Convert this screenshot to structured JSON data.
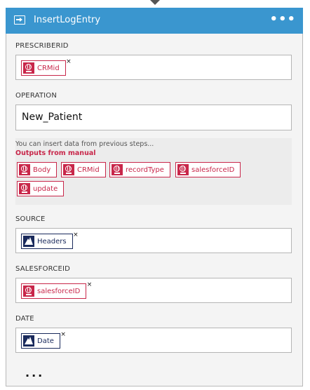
{
  "header": {
    "title": "InsertLogEntry",
    "more_label": "•••",
    "icon": "action-icon",
    "color": "#3a96cf"
  },
  "fields": {
    "prescriberid": {
      "label": "PRESCRIBERID",
      "tokens": [
        {
          "label": "CRMid",
          "remove": "×",
          "icon": "salesforce-globe-icon"
        }
      ]
    },
    "operation": {
      "label": "OPERATION",
      "value": "New_Patient"
    },
    "source": {
      "label": "SOURCE",
      "tokens": [
        {
          "label": "Headers",
          "remove": "×",
          "icon": "trigger-icon"
        }
      ]
    },
    "salesforceid": {
      "label": "SALESFORCEID",
      "tokens": [
        {
          "label": "salesforceID",
          "remove": "×",
          "icon": "salesforce-globe-icon"
        }
      ]
    },
    "date": {
      "label": "DATE",
      "tokens": [
        {
          "label": "Date",
          "remove": "×",
          "icon": "trigger-icon"
        }
      ]
    }
  },
  "dynamic_content": {
    "hint": "You can insert data from previous steps...",
    "heading": "Outputs from manual",
    "tokens": [
      "Body",
      "CRMid",
      "recordType",
      "salesforceID",
      "update"
    ]
  },
  "footer": {
    "more_label": "..."
  },
  "colors": {
    "token_red": "#c8274a",
    "token_blue": "#1a2a5c"
  }
}
